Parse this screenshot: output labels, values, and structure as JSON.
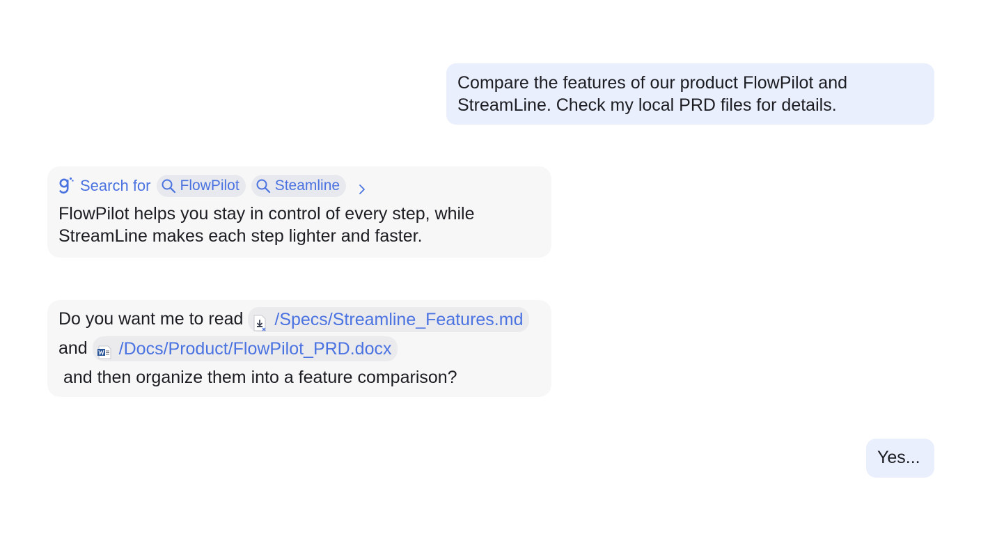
{
  "messages": {
    "user_first": {
      "text": "Compare the features of our product FlowPilot and StreamLine. Check my local PRD files for details."
    },
    "assistant_search": {
      "label": "Search for",
      "queries": [
        "FlowPilot",
        "Steamline"
      ],
      "answer": "FlowPilot helps you stay in control of every step, while StreamLine makes each step lighter and faster."
    },
    "assistant_question": {
      "prefix": "Do you want me to read ",
      "file1": "/Specs/Streamline_Features.md",
      "middle": "and ",
      "file2": "/Docs/Product/FlowPilot_PRD.docx",
      "suffix": " and then organize them into a feature comparison?"
    },
    "user_reply": {
      "text": "Yes..."
    }
  },
  "icons": {
    "brand": "brand-g-icon",
    "search": "search-icon",
    "expand": "chevron-right-icon",
    "markdown_file": "markdown-file-icon",
    "word_file": "word-file-icon"
  },
  "colors": {
    "link": "#4a72e0",
    "user_bubble": "#eaeffd",
    "assistant_bubble": "#f7f7f7"
  }
}
